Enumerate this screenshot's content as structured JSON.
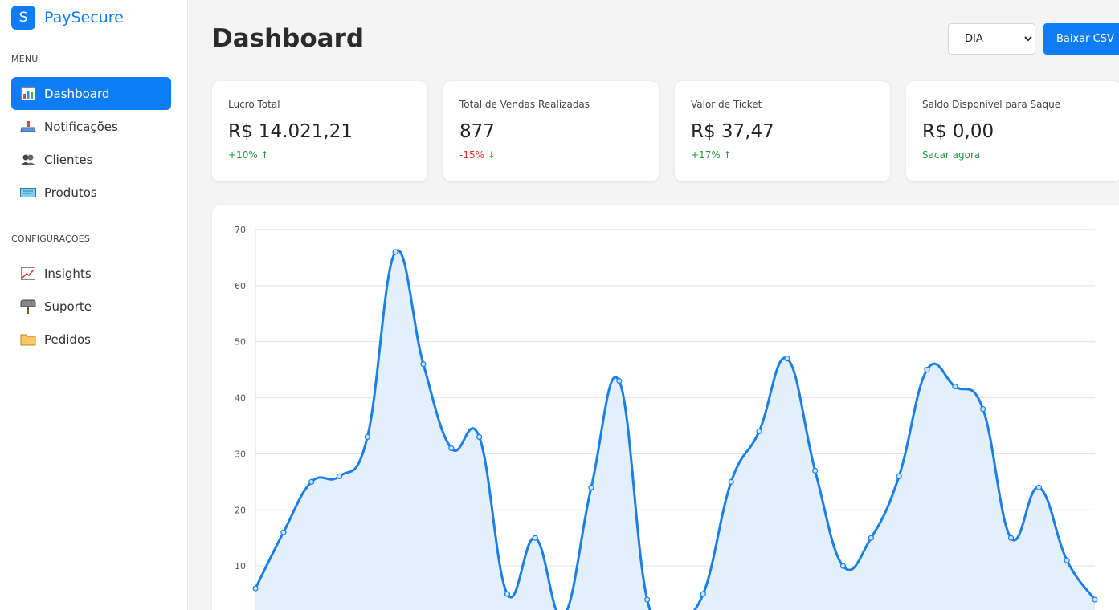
{
  "brand": {
    "logo_letter": "S",
    "name": "PaySecure",
    "color": "#0d7df5"
  },
  "sidebar": {
    "menu_label": "MENU",
    "menu_items": [
      {
        "label": "Dashboard",
        "icon": "bar-chart-icon",
        "active": true
      },
      {
        "label": "Notificações",
        "icon": "bell-icon",
        "active": false
      },
      {
        "label": "Clientes",
        "icon": "users-icon",
        "active": false
      },
      {
        "label": "Produtos",
        "icon": "ticket-icon",
        "active": false
      }
    ],
    "config_label": "CONFIGURAÇÕES",
    "config_items": [
      {
        "label": "Insights",
        "icon": "line-chart-icon"
      },
      {
        "label": "Suporte",
        "icon": "mailbox-icon"
      },
      {
        "label": "Pedidos",
        "icon": "folder-icon"
      }
    ]
  },
  "header": {
    "title": "Dashboard",
    "period_selected": "DIA",
    "csv_button": "Baixar CSV"
  },
  "cards": [
    {
      "label": "Lucro Total",
      "value": "R$ 14.021,21",
      "change": "+10% ↑",
      "trend": "up"
    },
    {
      "label": "Total de Vendas Realizadas",
      "value": "877",
      "change": "-15% ↓",
      "trend": "down"
    },
    {
      "label": "Valor de Ticket",
      "value": "R$ 37,47",
      "change": "+17% ↑",
      "trend": "up"
    },
    {
      "label": "Saldo Disponível para Saque",
      "value": "R$ 0,00",
      "change": "Sacar agora",
      "trend": "up"
    }
  ],
  "chart_data": {
    "type": "area",
    "title": "",
    "xlabel": "",
    "ylabel": "",
    "ylim": [
      0,
      70
    ],
    "yticks": [
      10,
      20,
      30,
      40,
      50,
      60,
      70
    ],
    "grid": true,
    "line_color": "#1a7fe6",
    "fill_color": "#e3f0fc",
    "series": [
      {
        "values": [
          6,
          16,
          25,
          26,
          33,
          66,
          46,
          31,
          33,
          5,
          15,
          1,
          24,
          43,
          4,
          1,
          5,
          25,
          34,
          47,
          27,
          10,
          15,
          26,
          45,
          42,
          38,
          15,
          24,
          11,
          4
        ]
      }
    ]
  }
}
